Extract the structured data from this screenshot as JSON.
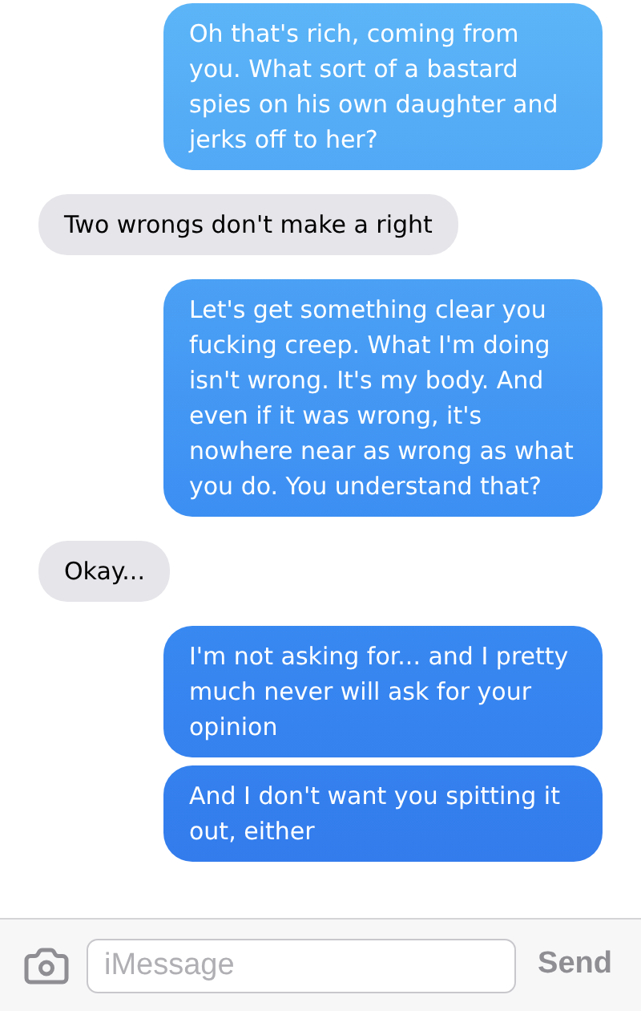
{
  "messages": [
    {
      "kind": "sent",
      "text": "Oh that's rich, coming from you. What sort of a bastard spies on his own daughter and jerks off to her?"
    },
    {
      "kind": "received",
      "text": "Two wrongs don't make a right"
    },
    {
      "kind": "sent",
      "text": "Let's get something clear you fucking creep. What I'm doing isn't wrong. It's my body. And even if it was wrong, it's nowhere near as wrong as what you do. You understand that?"
    },
    {
      "kind": "received",
      "text": "Okay..."
    },
    {
      "kind": "sent",
      "text": "I'm not asking for... and I pretty much never will ask for your opinion"
    },
    {
      "kind": "sent",
      "text": "And I don't want you spitting it out, either"
    }
  ],
  "composer": {
    "placeholder": "iMessage",
    "send": "Send"
  }
}
